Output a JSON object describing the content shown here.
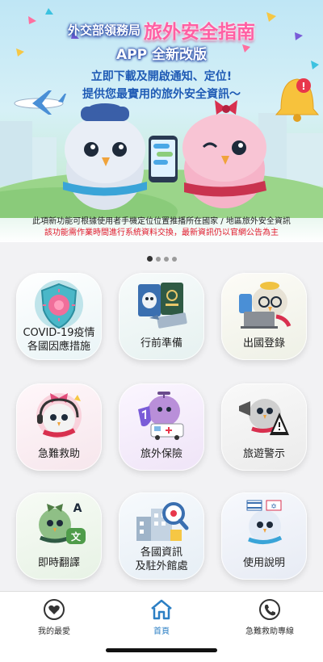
{
  "banner": {
    "ministry": "外交部領務局",
    "app_name": "旅外安全指南",
    "subtitle": "APP 全新改版",
    "line1": "立即下載及開啟通知、定位!",
    "line2": "提供您最實用的旅外安全資訊～"
  },
  "notice": {
    "line1": "此項新功能可根據使用者手機定位位置推播所在國家 / 地區旅外安全資訊",
    "line2": "該功能需作業時間進行系統資料交換，最新資訊仍以官網公告為主"
  },
  "pager": {
    "total": 4,
    "active": 0
  },
  "tiles": [
    {
      "line1": "COVID-19疫情",
      "line2": "各國因應措施",
      "icon": "covid-shield-icon"
    },
    {
      "line1": "行前準備",
      "line2": "",
      "icon": "passport-ticket-icon"
    },
    {
      "line1": "出國登錄",
      "line2": "",
      "icon": "laptop-registration-icon"
    },
    {
      "line1": "急難救助",
      "line2": "",
      "icon": "headset-helpdesk-icon"
    },
    {
      "line1": "旅外保險",
      "line2": "",
      "icon": "insurance-ambulance-icon"
    },
    {
      "line1": "旅遊警示",
      "line2": "",
      "icon": "warning-megaphone-icon"
    },
    {
      "line1": "即時翻譯",
      "line2": "",
      "icon": "translate-bubble-icon"
    },
    {
      "line1": "各國資訊",
      "line2": "及駐外館處",
      "icon": "embassy-search-icon"
    },
    {
      "line1": "使用說明",
      "line2": "",
      "icon": "instructions-flag-icon"
    }
  ],
  "bottom_nav": {
    "favorites": "我的最愛",
    "home": "首頁",
    "hotline": "急難救助專線"
  },
  "colors": {
    "accent_blue": "#2c7fc4",
    "notice_red": "#e0192b",
    "title_pink": "#ff5fa3"
  }
}
